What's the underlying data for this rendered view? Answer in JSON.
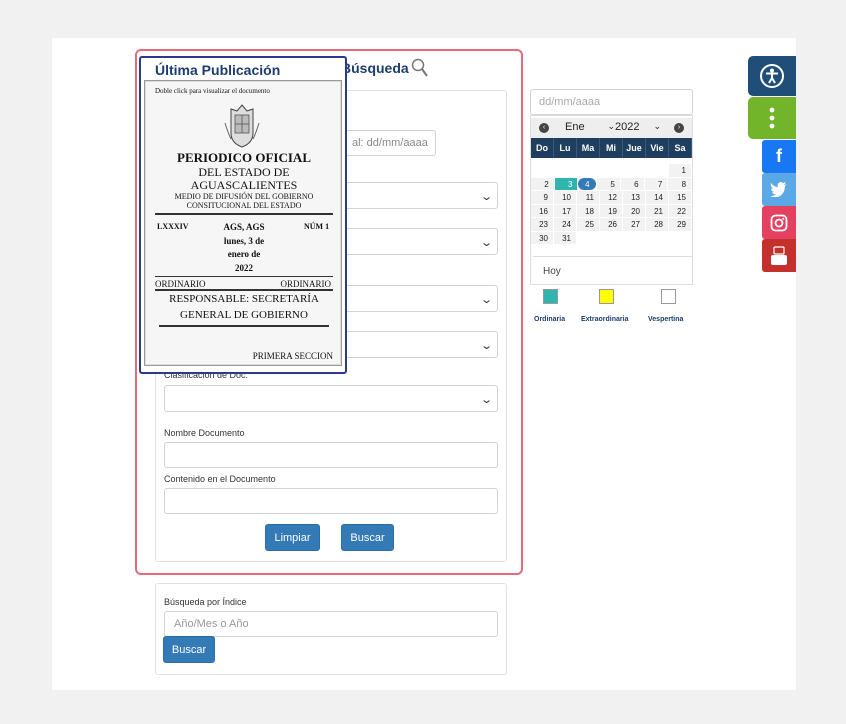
{
  "ultima": {
    "title": "Última Publicación",
    "hint": "Doble click para visualizar el documento",
    "doc_title": "PERIODICO OFICIAL",
    "doc_line2": "DEL ESTADO DE",
    "doc_line3": "AGUASCALIENTES",
    "doc_line4": "MEDIO DE DIFUSIÓN DEL GOBIERNO",
    "doc_line5": "CONSITUCIONAL DEL ESTADO",
    "tomo": "LXXXIV",
    "place": "AGS, AGS",
    "date1": "lunes, 3 de",
    "date2": "enero de",
    "date3": "2022",
    "num": "NÚM 1",
    "type_left": "ORDINARIO",
    "type_right": "ORDINARIO",
    "resp1": "RESPONSABLE: SECRETARÍA",
    "resp2": "GENERAL DE GOBIERNO",
    "section": "PRIMERA SECCION"
  },
  "search": {
    "title": "Búsqueda",
    "date_placeholder": "al: dd/mm/aaaa",
    "clasificacion_label": "Clasificación de Doc.",
    "nombre_label": "Nombre Documento",
    "contenido_label": "Contenido en el Documento",
    "limpiar_label": "Limpiar",
    "buscar_label": "Buscar"
  },
  "index_search": {
    "label": "Búsqueda por Índice",
    "placeholder": "Año/Mes o Año",
    "buscar_label": "Buscar"
  },
  "calendar": {
    "input_placeholder": "dd/mm/aaaa",
    "month": "Ene",
    "year": "2022",
    "days_of_week": [
      "Do",
      "Lu",
      "Ma",
      "Mi",
      "Jue",
      "Vie",
      "Sa"
    ],
    "weeks": [
      [
        "",
        "",
        "",
        "",
        "",
        "",
        "1"
      ],
      [
        "2",
        "3",
        "4",
        "5",
        "6",
        "7",
        "8"
      ],
      [
        "9",
        "10",
        "11",
        "12",
        "13",
        "14",
        "15"
      ],
      [
        "16",
        "17",
        "18",
        "19",
        "20",
        "21",
        "22"
      ],
      [
        "23",
        "24",
        "25",
        "26",
        "27",
        "28",
        "29"
      ],
      [
        "30",
        "31",
        "",
        "",
        "",
        "",
        ""
      ]
    ],
    "ordinaria_day": "3",
    "selected_day": "4",
    "today_label": "Hoy"
  },
  "legend": [
    {
      "label": "Ordinaria",
      "color": "#2fb5ad"
    },
    {
      "label": "Extraordinaria",
      "color": "#ffff00"
    },
    {
      "label": "Vespertina",
      "color": "#ffffff"
    }
  ],
  "social": [
    {
      "name": "accessibility-icon",
      "color": "#1f4e79"
    },
    {
      "name": "more-icon",
      "color": "#72b52a"
    },
    {
      "name": "facebook-icon",
      "color": "#1877f2",
      "glyph": "f"
    },
    {
      "name": "twitter-icon",
      "color": "#5aa9e6"
    },
    {
      "name": "instagram-icon",
      "color": "#e4405f"
    },
    {
      "name": "youtube-icon",
      "color": "#c4302b",
      "glyph": "You\nTube"
    }
  ]
}
